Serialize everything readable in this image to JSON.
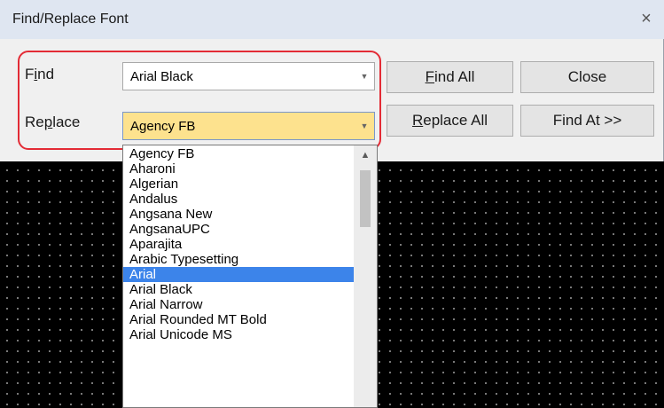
{
  "window": {
    "title": "Find/Replace Font",
    "close_glyph": "×"
  },
  "form": {
    "find_label_prefix": "F",
    "find_label_mnemonic": "i",
    "find_label_suffix": "nd",
    "replace_label_prefix": "Re",
    "replace_label_mnemonic": "p",
    "replace_label_suffix": "lace",
    "find_value": "Arial Black",
    "replace_value": "Agency FB"
  },
  "buttons": {
    "find_all_mnemonic": "F",
    "find_all_rest": "ind All",
    "close": "Close",
    "replace_all_mnemonic": "R",
    "replace_all_rest": "eplace All",
    "find_at": "Find At >>"
  },
  "dropdown": {
    "items": [
      "Agency FB",
      "Aharoni",
      "Algerian",
      "Andalus",
      "Angsana New",
      "AngsanaUPC",
      "Aparajita",
      "Arabic Typesetting",
      "Arial",
      "Arial Black",
      "Arial Narrow",
      "Arial Rounded MT Bold",
      "Arial Unicode MS"
    ],
    "selected": "Arial"
  },
  "icons": {
    "combo_arrow": "chevron-down-icon",
    "scroll_up": "scroll-up-icon",
    "close": "close-icon"
  },
  "colors": {
    "highlight_border": "#e32b35",
    "selection": "#3c84ea",
    "active_combo": "#fde28e"
  }
}
